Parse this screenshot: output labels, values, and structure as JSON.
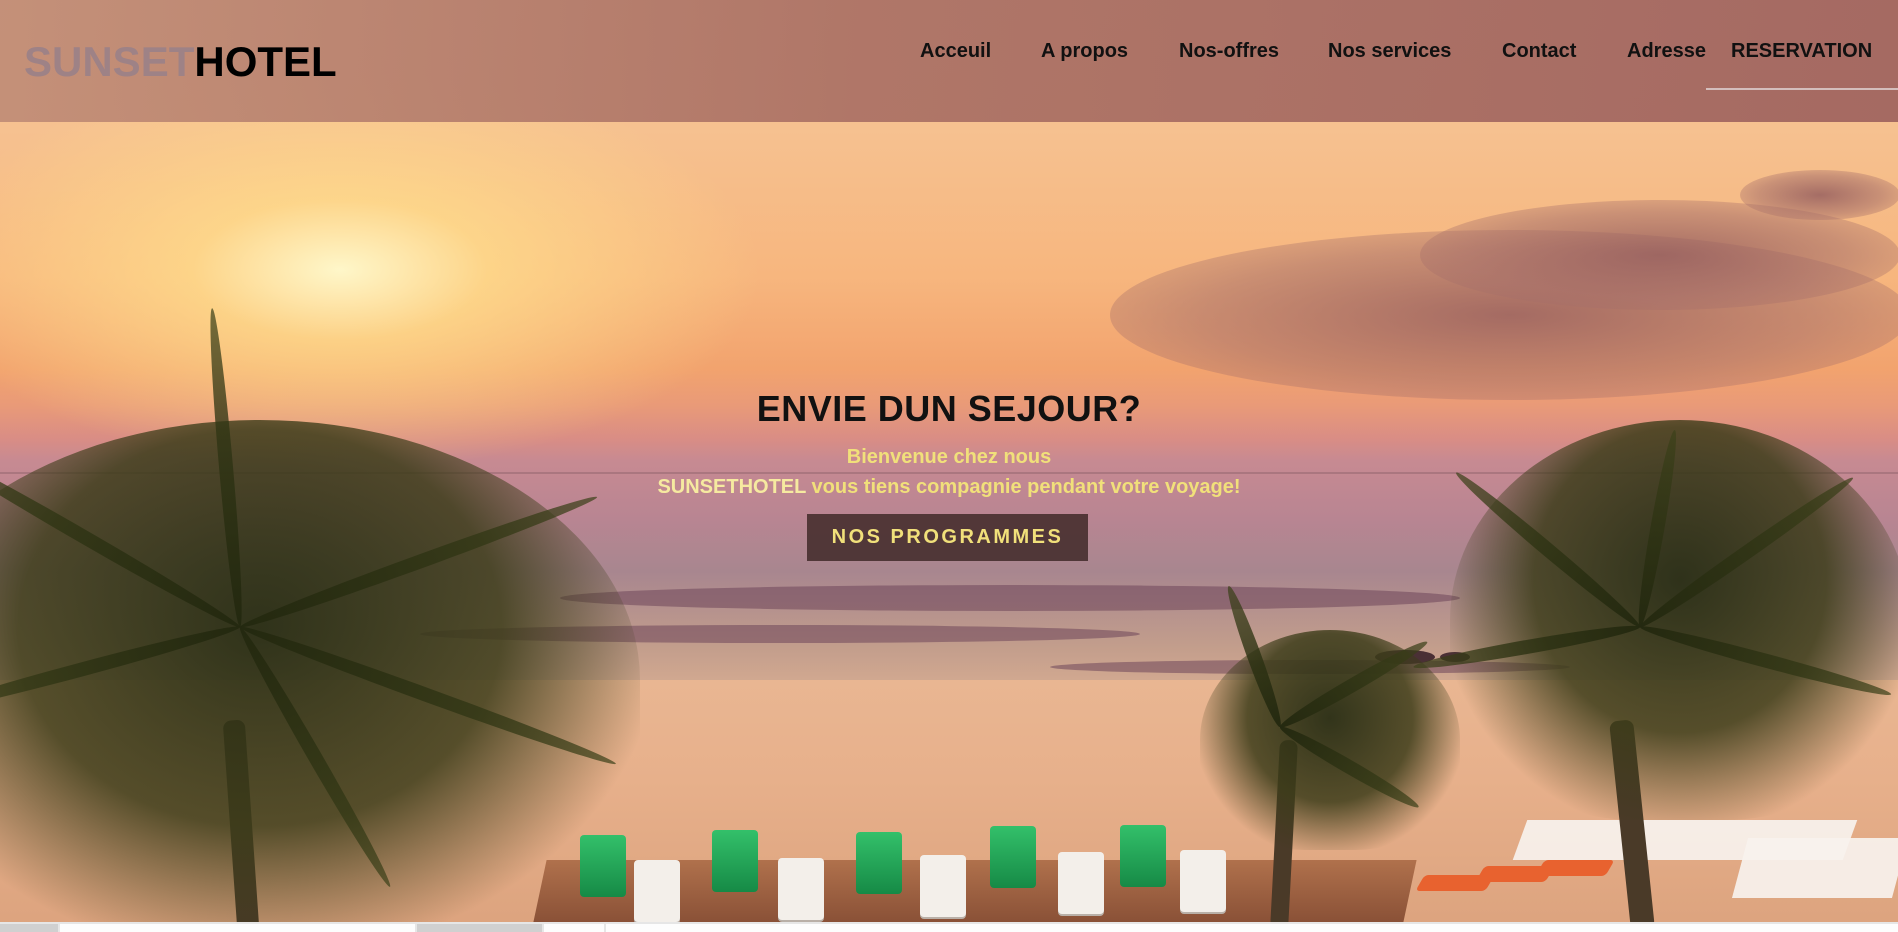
{
  "logo": {
    "part1": "SUNSET",
    "part2": "HOTEL"
  },
  "nav": [
    {
      "label": "Acceuil"
    },
    {
      "label": "A propos"
    },
    {
      "label": "Nos-offres"
    },
    {
      "label": "Nos services"
    },
    {
      "label": "Contact"
    },
    {
      "label": "Adresse"
    },
    {
      "label": "RESERVATION"
    }
  ],
  "hero": {
    "title": "ENVIE DUN SEJOUR?",
    "line1": "Bienvenue chez nous",
    "line2": "SUNSETHOTEL vous tiens compagnie pendant votre voyage!",
    "cta": "NOS PROGRAMMES"
  },
  "colors": {
    "header_bg": "#aa7064",
    "logo_muted": "#9e8286",
    "accent_text": "#f1e07a",
    "cta_bg": "#3c2624"
  }
}
